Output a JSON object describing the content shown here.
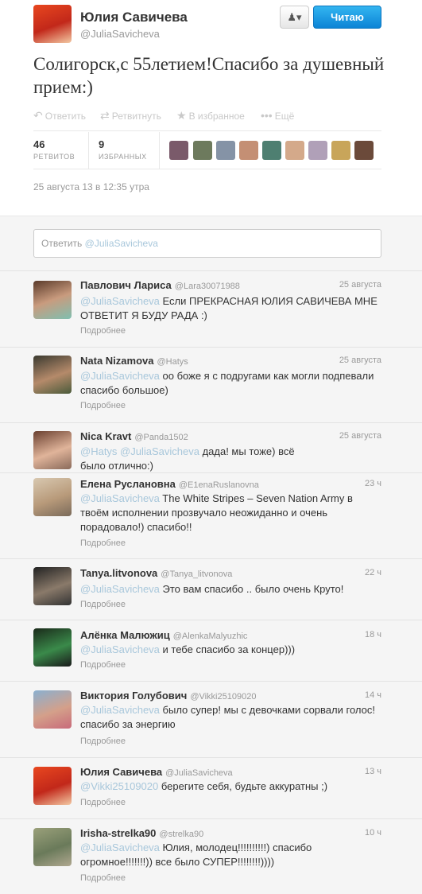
{
  "tweet": {
    "name": "Юлия Савичева",
    "handle": "@JuliaSavicheva",
    "follow_label": "Читаю",
    "text": "Солигорск,с 55летием!Спасибо за душевный прием:)",
    "actions": {
      "reply": "Ответить",
      "retweet": "Ретвитнуть",
      "favorite": "В избранное",
      "more": "Ещё"
    },
    "retweets_count": "46",
    "retweets_label": "РЕТВИТОВ",
    "favorites_count": "9",
    "favorites_label": "ИЗБРАННЫХ",
    "date": "25 августа 13 в 12:35 утра"
  },
  "reply_box": {
    "prefix": "Ответить",
    "mention": "@JuliaSavicheva"
  },
  "replies": [
    {
      "name": "Павлович Лариса",
      "handle": "@Lara30071988",
      "time": "25 августа",
      "mention": "@JuliaSavicheva",
      "text": " Если ПРЕКРАСНАЯ ЮЛИЯ САВИЧЕВА МНЕ ОТВЕТИТ Я БУДУ РАДА :)",
      "more": "Подробнее"
    },
    {
      "name": "Nata Nizamova",
      "handle": "@Hatys",
      "time": "25 августа",
      "mention": "@JuliaSavicheva",
      "text": " оо боже я с подругами как могли подпевали спасибо большое)",
      "more": "Подробнее"
    },
    {
      "name": "Nica Kravt",
      "handle": "@Panda1502",
      "time": "25 августа",
      "mention": "@Hatys @JuliaSavicheva",
      "text": " дада! мы тоже) всё было отлично:)",
      "more": ""
    },
    {
      "name": "Елена Руслановна",
      "handle": "@E1enaRuslanovna",
      "time": "23 ч",
      "mention": "@JuliaSavicheva",
      "text": "  The White Stripes – Seven Nation Army в твоём исполнении прозвучало неожиданно и очень порадовало!) спасибо!!",
      "more": "Подробнее"
    },
    {
      "name": "Tanya.litvonova",
      "handle": "@Tanya_litvonova",
      "time": "22 ч",
      "mention": "@JuliaSavicheva",
      "text": " Это вам спасибо .. было очень Круто!",
      "more": "Подробнее"
    },
    {
      "name": "Алёнка Малюжиц",
      "handle": "@AlenkaMalyuzhic",
      "time": "18 ч",
      "mention": "@JuliaSavicheva",
      "text": " и тебе спасибо за концер)))",
      "more": "Подробнее"
    },
    {
      "name": "Виктория Голубович",
      "handle": "@Vikki25109020",
      "time": "14 ч",
      "mention": "@JuliaSavicheva",
      "text": " было супер! мы с девочками сорвали голос!спасибо за энергию",
      "more": "Подробнее"
    },
    {
      "name": "Юлия Савичева",
      "handle": "@JuliaSavicheva",
      "time": "13 ч",
      "mention": "@Vikki25109020",
      "text": " берегите себя, будьте аккуратны ;)",
      "more": "Подробнее"
    },
    {
      "name": "Irisha-strelka90",
      "handle": "@strelka90",
      "time": "10 ч",
      "mention": "@JuliaSavicheva",
      "text": " Юлия, молодец!!!!!!!!!!) спасибо огромное!!!!!!!)) все было СУПЕР!!!!!!!!))))",
      "more": "Подробнее"
    }
  ],
  "colors": {
    "accent": "#1b95e0",
    "mention": "#a8c7db",
    "muted": "#999999"
  },
  "icons": {
    "reply": "reply-icon",
    "retweet": "retweet-icon",
    "favorite": "star-icon",
    "more": "more-dots-icon",
    "user": "user-icon"
  }
}
